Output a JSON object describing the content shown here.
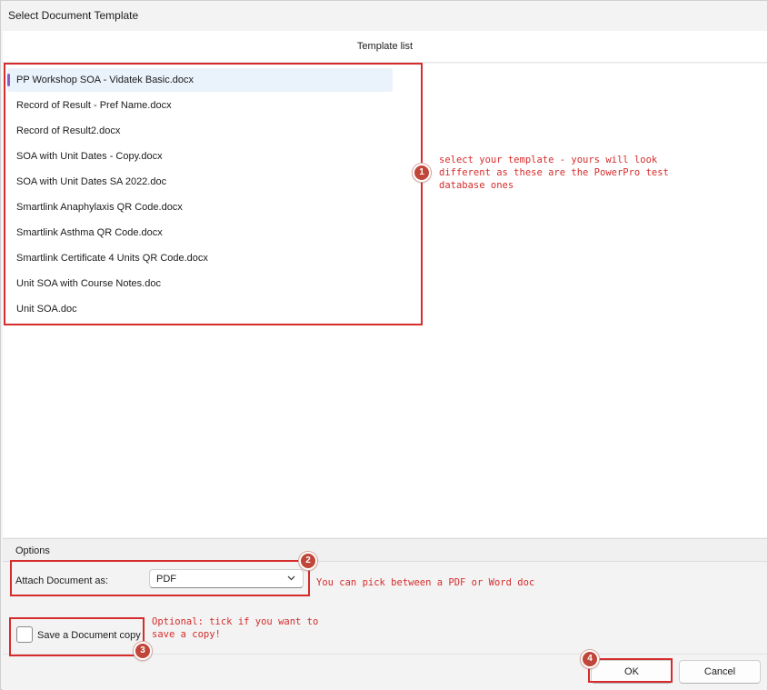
{
  "window": {
    "title": "Select Document Template"
  },
  "template_list": {
    "header": "Template list",
    "items": [
      {
        "label": "PP Workshop SOA - Vidatek Basic.docx",
        "selected": true
      },
      {
        "label": "Record of Result - Pref Name.docx",
        "selected": false
      },
      {
        "label": "Record of Result2.docx",
        "selected": false
      },
      {
        "label": "SOA with Unit Dates - Copy.docx",
        "selected": false
      },
      {
        "label": "SOA with Unit Dates SA 2022.doc",
        "selected": false
      },
      {
        "label": "Smartlink Anaphylaxis QR Code.docx",
        "selected": false
      },
      {
        "label": "Smartlink Asthma QR Code.docx",
        "selected": false
      },
      {
        "label": "Smartlink Certificate 4 Units QR Code.docx",
        "selected": false
      },
      {
        "label": "Unit SOA with Course Notes.doc",
        "selected": false
      },
      {
        "label": "Unit SOA.doc",
        "selected": false
      }
    ]
  },
  "options": {
    "header": "Options",
    "attach_label": "Attach Document as:",
    "attach_value": "PDF",
    "save_copy_label": "Save a Document copy",
    "save_copy_checked": false
  },
  "buttons": {
    "ok": "OK",
    "cancel": "Cancel"
  },
  "annotations": {
    "badge1": "1",
    "badge2": "2",
    "badge3": "3",
    "badge4": "4",
    "note1_line1": "select your template - yours will look",
    "note1_line2": "different as these are the PowerPro test",
    "note1_line3": "database ones",
    "note2": "You can pick between a PDF or Word doc",
    "note3_line1": "Optional: tick if you want to",
    "note3_line2": "save a copy!"
  },
  "colors": {
    "annotation_red": "#d62c2c",
    "badge": "#c0463a",
    "selection_bar": "#8a5cc8",
    "selection_bg": "#eaf2fb"
  },
  "icons": {
    "select_chevron": "chevron-down-icon"
  }
}
